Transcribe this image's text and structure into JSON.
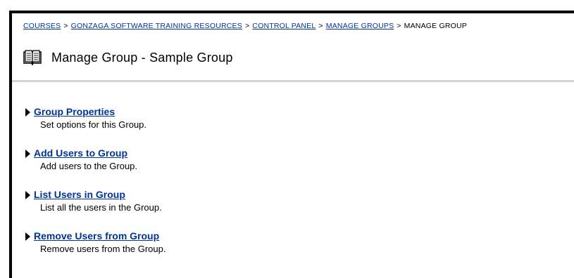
{
  "breadcrumb": {
    "items": [
      {
        "label": "COURSES"
      },
      {
        "label": "GONZAGA SOFTWARE TRAINING RESOURCES"
      },
      {
        "label": "CONTROL PANEL"
      },
      {
        "label": "MANAGE GROUPS"
      }
    ],
    "separator": ">",
    "current": "MANAGE GROUP"
  },
  "header": {
    "title": "Manage Group - Sample Group",
    "icon": "book-icon"
  },
  "menu": {
    "items": [
      {
        "label": "Group Properties",
        "description": "Set options for this Group."
      },
      {
        "label": "Add Users to Group",
        "description": "Add users to the Group."
      },
      {
        "label": "List Users in Group",
        "description": "List all the users in the Group."
      },
      {
        "label": "Remove Users from Group",
        "description": "Remove users from the Group."
      }
    ]
  },
  "colors": {
    "link": "#003399",
    "divider": "#d4d4d4",
    "frame_border": "#000000"
  }
}
